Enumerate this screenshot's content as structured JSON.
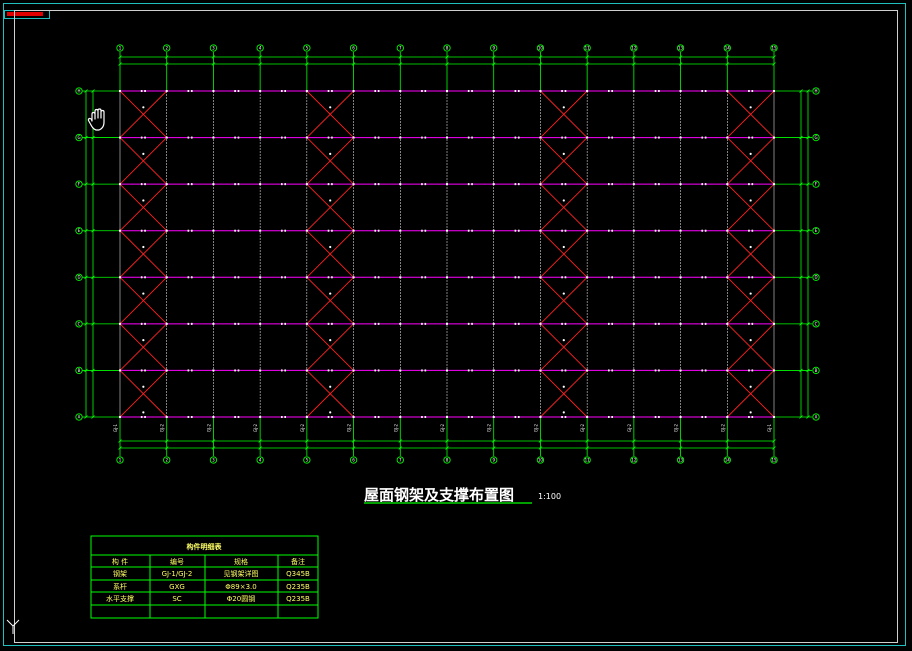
{
  "drawing": {
    "title": "屋面钢架及支撑布置图",
    "scale": "1:100",
    "colors": {
      "background": "#000000",
      "frame": "#1fbfbf",
      "grid": "#00ff00",
      "purlin": "#ff00ff",
      "bracing": "#ff2020",
      "column_line": "#ffffff",
      "text": "#ffffff",
      "table_text": "#ffff66",
      "tab_marker": "#e00000"
    },
    "column_axis_labels": [
      "1",
      "2",
      "3",
      "4",
      "5",
      "6",
      "7",
      "8",
      "9",
      "10",
      "11",
      "12",
      "13",
      "14",
      "15"
    ],
    "row_axis_labels": [
      "H",
      "G",
      "F",
      "E",
      "D",
      "C",
      "B",
      "A"
    ],
    "braced_bays": [
      0,
      4,
      9,
      13
    ],
    "frame_marks": [
      "GJ-1",
      "GJ-2",
      "GJ-2",
      "GJ-2",
      "GJ-2",
      "GJ-2",
      "GJ-2",
      "GJ-2",
      "GJ-2",
      "GJ-2",
      "GJ-2",
      "GJ-2",
      "GJ-2",
      "GJ-2",
      "GJ-1"
    ]
  },
  "table": {
    "title": "构件明细表",
    "headers": [
      "构 件",
      "编号",
      "规格",
      "备注"
    ],
    "rows": [
      [
        "钢架",
        "GJ-1/GJ-2",
        "见钢架详图",
        "Q345B"
      ],
      [
        "系杆",
        "GXG",
        "Φ89×3.0",
        "Q235B"
      ],
      [
        "水平支撑",
        "SC",
        "Φ20圆钢",
        "Q235B"
      ]
    ]
  },
  "ui": {
    "ucs_label": "Y"
  }
}
